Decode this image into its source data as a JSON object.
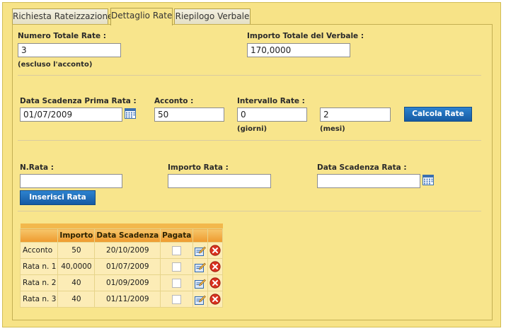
{
  "tabs": [
    {
      "label": "Richiesta Rateizzazione",
      "active": false
    },
    {
      "label": "Dettaglio Rate",
      "active": true
    },
    {
      "label": "Riepilogo Verbale",
      "active": false
    }
  ],
  "header": {
    "numero_totale_rate": {
      "label": "Numero Totale Rate :",
      "value": "3",
      "note": "(escluso l'acconto)"
    },
    "importo_totale": {
      "label": "Importo Totale del Verbale :",
      "value": "170,0000"
    }
  },
  "params": {
    "data_scadenza": {
      "label": "Data Scadenza Prima Rata :",
      "value": "01/07/2009"
    },
    "acconto": {
      "label": "Acconto :",
      "value": "50"
    },
    "intervallo": {
      "label": "Intervallo Rate :",
      "giorni_value": "0",
      "giorni_unit": "(giorni)",
      "mesi_value": "2",
      "mesi_unit": "(mesi)"
    },
    "calcola_label": "Calcola Rate"
  },
  "insert": {
    "nrata_label": "N.Rata :",
    "nrata_value": "",
    "importo_label": "Importo Rata :",
    "importo_value": "",
    "scadenza_label": "Data Scadenza Rata :",
    "scadenza_value": "",
    "button_label": "Inserisci Rata"
  },
  "table": {
    "columns": [
      "",
      "Importo",
      "Data Scadenza",
      "Pagata",
      "",
      ""
    ],
    "rows": [
      {
        "name": "Acconto",
        "importo": "50",
        "scadenza": "20/10/2009"
      },
      {
        "name": "Rata n. 1",
        "importo": "40,0000",
        "scadenza": "01/07/2009"
      },
      {
        "name": "Rata n. 2",
        "importo": "40",
        "scadenza": "01/09/2009"
      },
      {
        "name": "Rata n. 3",
        "importo": "40",
        "scadenza": "01/11/2009"
      }
    ]
  },
  "colors": {
    "panel": "#f8e58c",
    "button": "#1d69b6",
    "table_header": "#f0a33a",
    "delete": "#d9321f"
  }
}
